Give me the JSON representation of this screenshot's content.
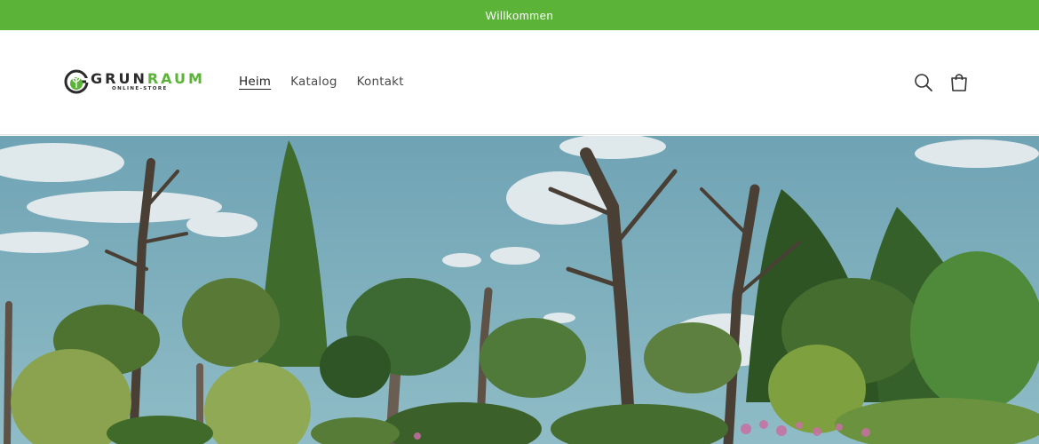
{
  "announcement": {
    "text": "Willkommen"
  },
  "brand": {
    "name_part1": "GRUN",
    "name_part2": "RAUM",
    "tagline": "ONLINE-STORE",
    "logo_icon": "leaf-in-g-icon"
  },
  "nav": {
    "items": [
      {
        "label": "Heim",
        "active": true
      },
      {
        "label": "Katalog",
        "active": false
      },
      {
        "label": "Kontakt",
        "active": false
      }
    ]
  },
  "header_icons": {
    "search": "search-icon",
    "cart": "shopping-bag-icon"
  },
  "hero": {
    "image": "garden-with-trees-and-shrubs"
  },
  "colors": {
    "accent": "#5bb337",
    "announcement_text": "#ffffff",
    "text": "#3a3a3a",
    "sky": "#79aab9"
  }
}
